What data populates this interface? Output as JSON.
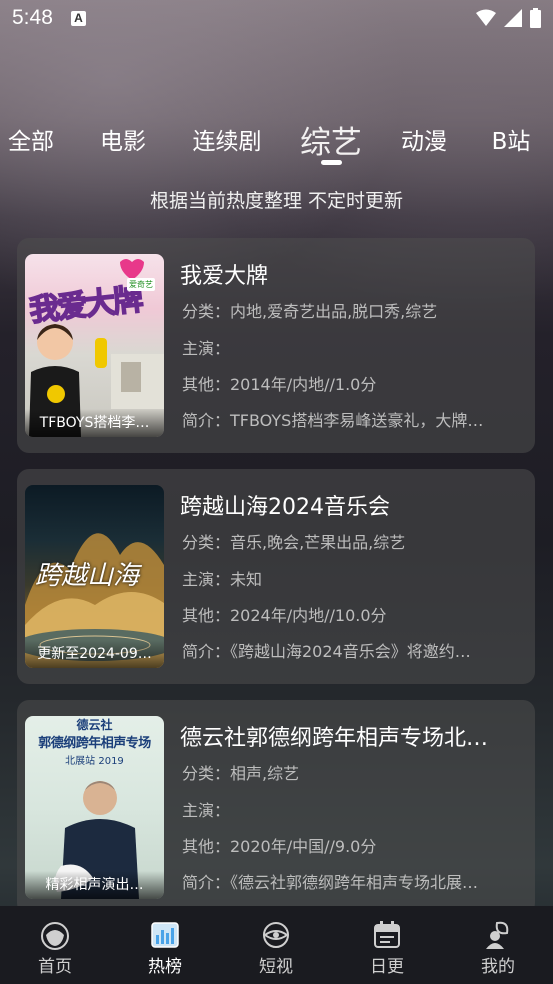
{
  "status_bar": {
    "time": "5:48",
    "notification_letter": "A"
  },
  "tabs": [
    {
      "label": "全部"
    },
    {
      "label": "电影"
    },
    {
      "label": "连续剧"
    },
    {
      "label": "综艺",
      "active": true
    },
    {
      "label": "动漫"
    },
    {
      "label": "B站"
    }
  ],
  "subtitle": "根据当前热度整理 不定时更新",
  "items": [
    {
      "title": "我爱大牌",
      "category": "分类：内地,爱奇艺出品,脱口秀,综艺",
      "cast": "主演：",
      "other": "其他：2014年/内地//1.0分",
      "summary": "简介：TFBOYS搭档李易峰送豪礼，大牌…",
      "poster_caption": "TFBOYS搭档李…",
      "poster_text": "我爱大牌",
      "poster_logo": "爱奇艺"
    },
    {
      "title": "跨越山海2024音乐会",
      "category": "分类：音乐,晚会,芒果出品,综艺",
      "cast": "主演：未知",
      "other": "其他：2024年/内地//10.0分",
      "summary": "简介：《跨越山海2024音乐会》将邀约…",
      "poster_caption": "更新至2024-09…",
      "poster_text": "跨越山海"
    },
    {
      "title": "德云社郭德纲跨年相声专场北…",
      "category": "分类：相声,综艺",
      "cast": "主演：",
      "other": "其他：2020年/中国//9.0分",
      "summary": "简介：《德云社郭德纲跨年相声专场北展…",
      "poster_caption": "精彩相声演出…",
      "poster_top": "德云社",
      "poster_title": "郭德纲跨年相声专场",
      "poster_sub": "北展站 2019"
    }
  ],
  "nav": [
    {
      "label": "首页",
      "icon": "home-icon"
    },
    {
      "label": "热榜",
      "icon": "chart-icon",
      "active": true
    },
    {
      "label": "短视",
      "icon": "video-icon"
    },
    {
      "label": "日更",
      "icon": "calendar-icon"
    },
    {
      "label": "我的",
      "icon": "profile-icon"
    }
  ],
  "colors": {
    "accent": "#4aa3e8",
    "card_bg": "#4e4e4e"
  }
}
